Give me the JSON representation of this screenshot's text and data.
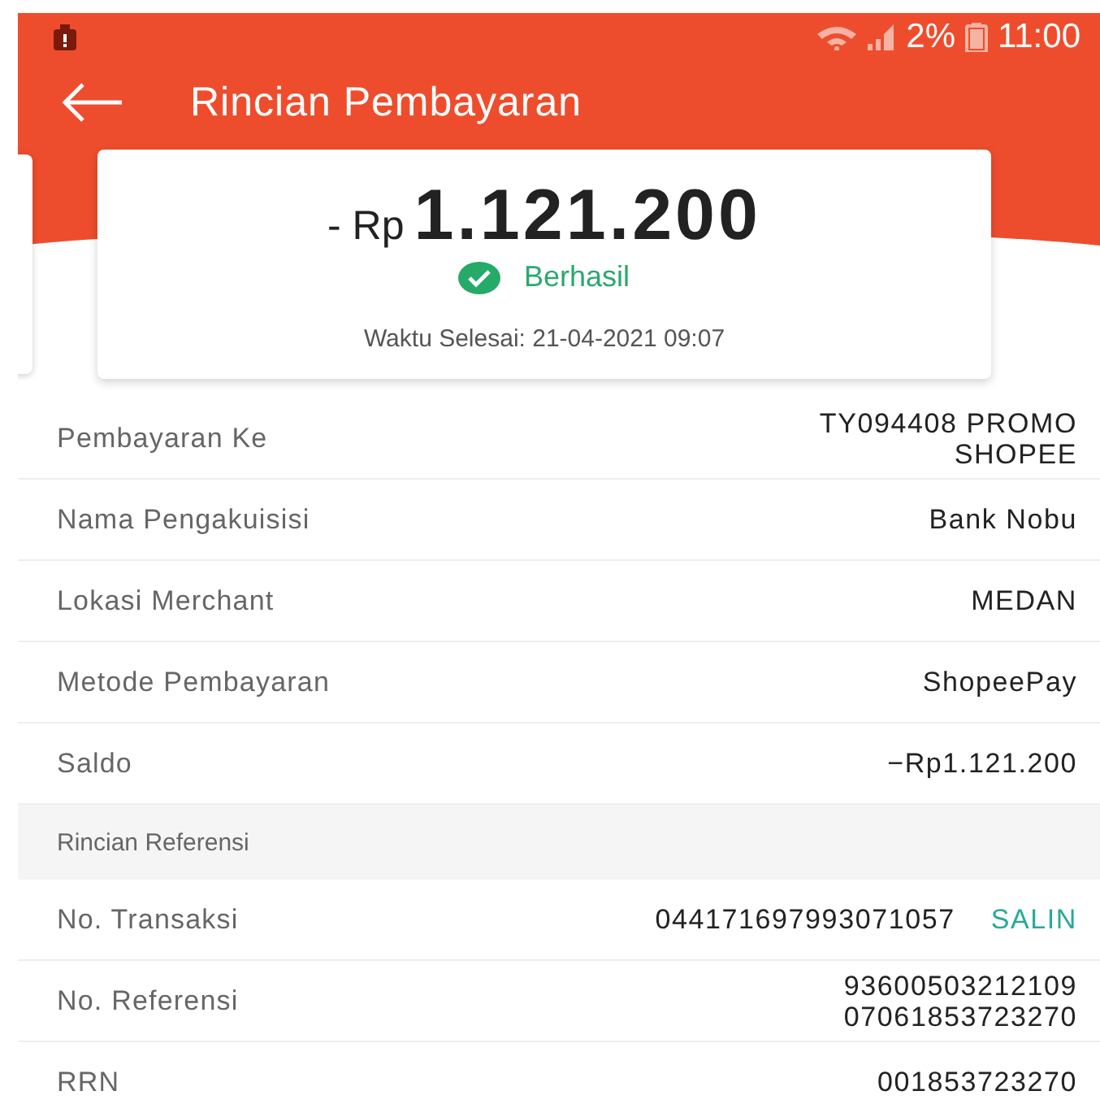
{
  "status_bar": {
    "battery": "2%",
    "time": "11:00"
  },
  "app_bar": {
    "title": "Rincian Pembayaran"
  },
  "summary": {
    "prefix": "- Rp",
    "amount": "1.121.200",
    "status": {
      "kind": "success",
      "label": "Berhasil"
    },
    "completed": "Waktu Selesai: 21-04-2021 09:07"
  },
  "rows": [
    {
      "kind": "detail",
      "label": "Pembayaran Ke",
      "value": "TY094408 PROMO\nSHOPEE"
    },
    {
      "kind": "detail",
      "label": "Nama Pengakuisisi",
      "value": "Bank Nobu"
    },
    {
      "kind": "detail",
      "label": "Lokasi Merchant",
      "value": "MEDAN"
    },
    {
      "kind": "detail",
      "label": "Metode Pembayaran",
      "value": "ShopeePay"
    },
    {
      "kind": "detail",
      "label": "Saldo",
      "value": "−Rp1.121.200"
    },
    {
      "kind": "section",
      "label": "Rincian Referensi"
    },
    {
      "kind": "detail",
      "label": "No. Transaksi",
      "value": "044171697993071057",
      "action": "SALIN"
    },
    {
      "kind": "detail",
      "label": "No. Referensi",
      "value": "93600503212109\n07061853723270"
    },
    {
      "kind": "detail",
      "label": "RRN",
      "value": "001853723270"
    }
  ]
}
